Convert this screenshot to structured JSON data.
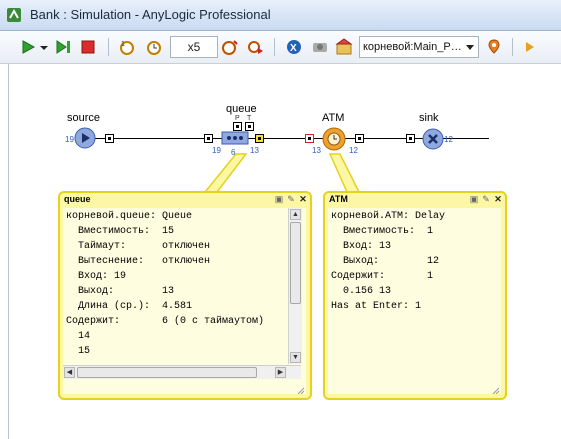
{
  "window": {
    "title": "Bank : Simulation - AnyLogic Professional"
  },
  "toolbar": {
    "speed": "x5",
    "experiment_selector": "корневой:Main_P…"
  },
  "model": {
    "source": {
      "label": "source",
      "out": "19"
    },
    "queue": {
      "label": "queue",
      "in": "19",
      "out": "13",
      "count": "6",
      "p": "P",
      "t": "T"
    },
    "atm": {
      "label": "ATM",
      "in": "13",
      "out": "12"
    },
    "sink": {
      "label": "sink",
      "in": "12"
    }
  },
  "popups": {
    "queue": {
      "title": "queue",
      "rows": [
        "корневой.queue: Queue",
        "  Вместимость:  15",
        "  Таймаут:      отключен",
        "  Вытеснение:   отключен",
        "  Вход: 19",
        "  Выход:        13",
        "  Длина (ср.):  4.581",
        "Содержит:       6 (0 с таймаутом)",
        "  14",
        "  15"
      ]
    },
    "atm": {
      "title": "ATM",
      "rows": [
        "корневой.ATM: Delay",
        "  Вместимость:  1",
        "  Вход: 13",
        "  Выход:        12",
        "Содержит:       1",
        "  0.156 13",
        "Has at Enter: 1"
      ]
    }
  },
  "colors": {
    "popup_fill": "#fcf7a4",
    "popup_border": "#e4d21c",
    "block_blue": "#8fa8e0",
    "atm_orange": "#f0a030",
    "flow_number": "#2f58c4"
  }
}
